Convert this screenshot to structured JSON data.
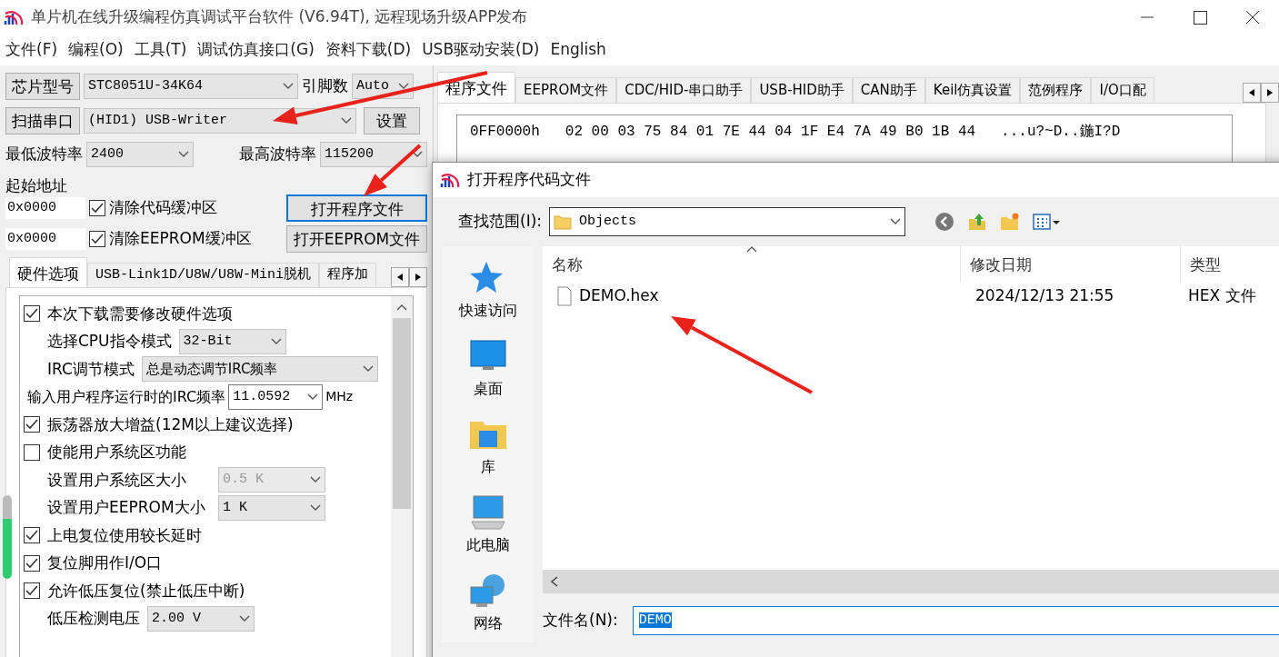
{
  "window": {
    "title": "单片机在线升级编程仿真调试平台软件 (V6.94T), 远程现场升级APP发布"
  },
  "menu": [
    "文件(F)",
    "编程(O)",
    "工具(T)",
    "调试仿真接口(G)",
    "资料下载(D)",
    "USB驱动安装(D)",
    "English"
  ],
  "left_panel": {
    "chip_button": "芯片型号",
    "chip_value": "STC8051U-34K64",
    "pins_label": "引脚数",
    "pins_value": "Auto",
    "scan_button": "扫描串口",
    "port_value": "(HID1) USB-Writer",
    "settings_button": "设置",
    "min_baud_label": "最低波特率",
    "min_baud": "2400",
    "max_baud_label": "最高波特率",
    "max_baud": "115200",
    "start_address_label": "起始地址",
    "address_rows": [
      {
        "value": "0x0000",
        "label": "清除代码缓冲区",
        "checked": true,
        "button": "打开程序文件",
        "focused": true
      },
      {
        "value": "0x0000",
        "label": "清除EEPROM缓冲区",
        "checked": true,
        "button": "打开EEPROM文件",
        "focused": false
      }
    ],
    "tabs": [
      {
        "label": "硬件选项",
        "selected": true
      },
      {
        "label": "USB-Link1D/U8W/U8W-Mini脱机",
        "selected": false
      },
      {
        "label": "程序加",
        "selected": false
      }
    ],
    "options": [
      {
        "kind": "checkbox",
        "label": "本次下载需要修改硬件选项",
        "checked": true
      },
      {
        "kind": "select",
        "label": "选择CPU指令模式",
        "value": "32-Bit",
        "disabled": false
      },
      {
        "kind": "select",
        "label": "IRC调节模式",
        "value": "总是动态调节IRC频率",
        "disabled": false
      },
      {
        "kind": "combo",
        "label": "输入用户程序运行时的IRC频率",
        "value": "11.0592",
        "unit": "MHz"
      },
      {
        "kind": "checkbox",
        "label": "振荡器放大增益(12M以上建议选择)",
        "checked": true
      },
      {
        "kind": "checkbox",
        "label": "使能用户系统区功能",
        "checked": false
      },
      {
        "kind": "select",
        "label": "设置用户系统区大小",
        "value": "0.5 K",
        "disabled": true
      },
      {
        "kind": "select",
        "label": "设置用户EEPROM大小",
        "value": "1    K",
        "disabled": false
      },
      {
        "kind": "checkbox",
        "label": "上电复位使用较长延时",
        "checked": true
      },
      {
        "kind": "checkbox",
        "label": "复位脚用作I/O口",
        "checked": true
      },
      {
        "kind": "checkbox",
        "label": "允许低压复位(禁止低压中断)",
        "checked": true
      },
      {
        "kind": "select",
        "label": "低压检测电压",
        "value": "2.00 V",
        "disabled": false
      }
    ]
  },
  "right_panel": {
    "tabs": [
      {
        "label": "程序文件",
        "selected": true
      },
      {
        "label": "EEPROM文件",
        "selected": false
      },
      {
        "label": "CDC/HID-串口助手",
        "selected": false
      },
      {
        "label": "USB-HID助手",
        "selected": false
      },
      {
        "label": "CAN助手",
        "selected": false
      },
      {
        "label": "Keil仿真设置",
        "selected": false
      },
      {
        "label": "范例程序",
        "selected": false
      },
      {
        "label": "I/O口配",
        "selected": false
      }
    ],
    "hex_rows": [
      {
        "address": "0FF0000h",
        "bytes": "02 00 03 75 84 01 7E 44 04 1F E4 7A 49 B0 1B 44",
        "ascii": "...u?~D..鍦I?D"
      }
    ]
  },
  "dialog": {
    "title": "打开程序代码文件",
    "look_in_label": "查找范围(I):",
    "folder": "Objects",
    "places": [
      {
        "label": "快速访问",
        "kind": "star"
      },
      {
        "label": "桌面",
        "kind": "desktop"
      },
      {
        "label": "库",
        "kind": "library"
      },
      {
        "label": "此电脑",
        "kind": "computer"
      },
      {
        "label": "网络",
        "kind": "network"
      }
    ],
    "columns": [
      "名称",
      "修改日期",
      "类型"
    ],
    "files": [
      {
        "name": "DEMO.hex",
        "modified": "2024/12/13 21:55",
        "type": "HEX 文件"
      }
    ],
    "filename_label": "文件名(N):",
    "filename": "DEMO"
  }
}
